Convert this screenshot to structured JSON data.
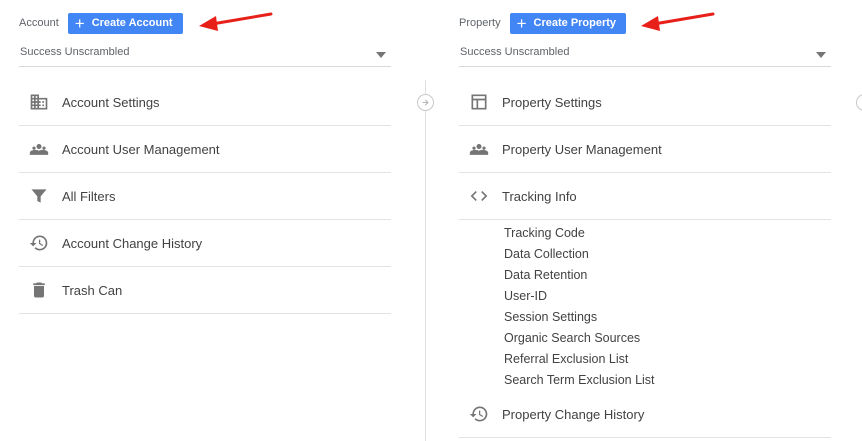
{
  "account": {
    "label": "Account",
    "create_label": "Create Account",
    "dropdown_value": "Success Unscrambled",
    "items": [
      {
        "label": "Account Settings",
        "icon": "building-icon"
      },
      {
        "label": "Account User Management",
        "icon": "people-icon"
      },
      {
        "label": "All Filters",
        "icon": "filter-icon"
      },
      {
        "label": "Account Change History",
        "icon": "history-icon"
      },
      {
        "label": "Trash Can",
        "icon": "trash-icon"
      }
    ]
  },
  "property": {
    "label": "Property",
    "create_label": "Create Property",
    "dropdown_value": "Success Unscrambled",
    "items": [
      {
        "label": "Property Settings",
        "icon": "layout-icon"
      },
      {
        "label": "Property User Management",
        "icon": "people-icon"
      },
      {
        "label": "Tracking Info",
        "icon": "code-icon"
      }
    ],
    "tracking_subitems": [
      "Tracking Code",
      "Data Collection",
      "Data Retention",
      "User-ID",
      "Session Settings",
      "Organic Search Sources",
      "Referral Exclusion List",
      "Search Term Exclusion List"
    ],
    "change_history_label": "Property Change History"
  },
  "colors": {
    "accent": "#4285f4",
    "annotation_arrow": "#e8201a",
    "icon": "#757575"
  }
}
